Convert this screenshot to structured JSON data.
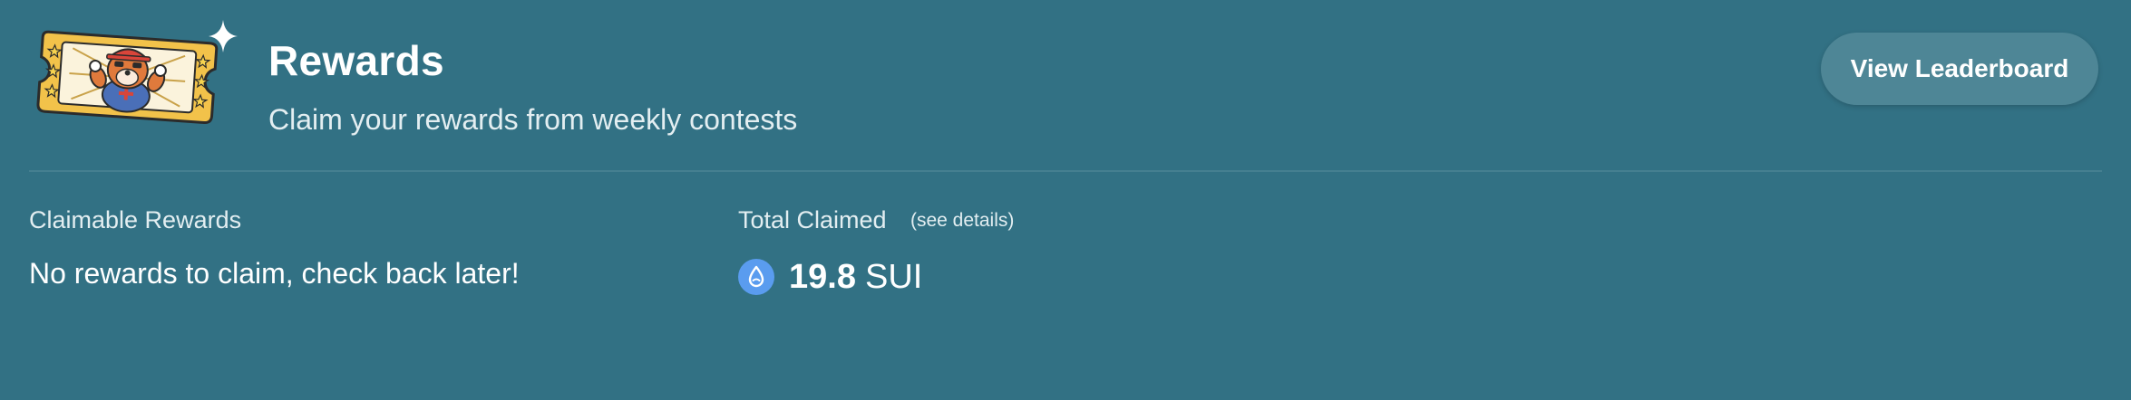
{
  "header": {
    "title": "Rewards",
    "subtitle": "Claim your rewards from weekly contests",
    "leaderboard_button": "View Leaderboard"
  },
  "claimable": {
    "label": "Claimable Rewards",
    "value": "No rewards to claim, check back later!"
  },
  "total_claimed": {
    "label": "Total Claimed",
    "details_link": "(see details)",
    "amount": "19.8",
    "unit": "SUI",
    "icon": "sui-drop-icon"
  },
  "colors": {
    "background": "#327184",
    "button": "#4e8696",
    "divider": "#457f90",
    "sui_icon": "#5a9cef",
    "ticket_gold": "#f2c24a"
  },
  "icons": {
    "hero": "reward-ticket-icon",
    "sparkle": "sparkle-icon"
  }
}
